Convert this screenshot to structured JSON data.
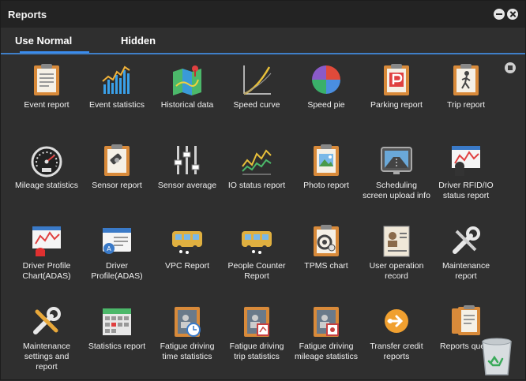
{
  "window": {
    "title": "Reports"
  },
  "tabs": [
    {
      "label": "Use Normal"
    },
    {
      "label": "Hidden"
    }
  ],
  "items": [
    {
      "label": "Event report",
      "icon": "clipboard-icon"
    },
    {
      "label": "Event statistics",
      "icon": "bar-chart-icon"
    },
    {
      "label": "Historical data",
      "icon": "map-pin-icon"
    },
    {
      "label": "Speed curve",
      "icon": "curve-chart-icon"
    },
    {
      "label": "Speed pie",
      "icon": "pie-chart-icon"
    },
    {
      "label": "Parking report",
      "icon": "parking-icon"
    },
    {
      "label": "Trip report",
      "icon": "pedestrian-icon"
    },
    {
      "label": "Mileage statistics",
      "icon": "speedometer-icon"
    },
    {
      "label": "Sensor report",
      "icon": "sensor-icon"
    },
    {
      "label": "Sensor average",
      "icon": "sliders-icon"
    },
    {
      "label": "IO status report",
      "icon": "line-chart-icon"
    },
    {
      "label": "Photo report",
      "icon": "photo-icon"
    },
    {
      "label": "Scheduling screen upload info",
      "icon": "road-screen-icon"
    },
    {
      "label": "Driver RFID/IO status report",
      "icon": "driver-chart-icon"
    },
    {
      "label": "Driver Profile Chart(ADAS)",
      "icon": "alarm-chart-icon"
    },
    {
      "label": "Driver Profile(ADAS)",
      "icon": "profile-card-icon"
    },
    {
      "label": "VPC Report",
      "icon": "bus-icon"
    },
    {
      "label": "People Counter Report",
      "icon": "bus-people-icon"
    },
    {
      "label": "TPMS chart",
      "icon": "tire-gauge-icon"
    },
    {
      "label": "User operation record",
      "icon": "user-record-icon"
    },
    {
      "label": "Maintenance report",
      "icon": "wrench-icon"
    },
    {
      "label": "Maintenance settings and report",
      "icon": "tools-icon"
    },
    {
      "label": "Statistics report",
      "icon": "calendar-table-icon"
    },
    {
      "label": "Fatigue driving time statistics",
      "icon": "fatigue-clock-icon"
    },
    {
      "label": "Fatigue driving trip statistics",
      "icon": "fatigue-trip-icon"
    },
    {
      "label": "Fatigue driving mileage statistics",
      "icon": "fatigue-mileage-icon"
    },
    {
      "label": "Transfer credit reports",
      "icon": "transfer-icon"
    },
    {
      "label": "Reports query",
      "icon": "documents-icon"
    }
  ],
  "colors": {
    "accent": "#3a8df0",
    "background": "#2f2f2f"
  }
}
